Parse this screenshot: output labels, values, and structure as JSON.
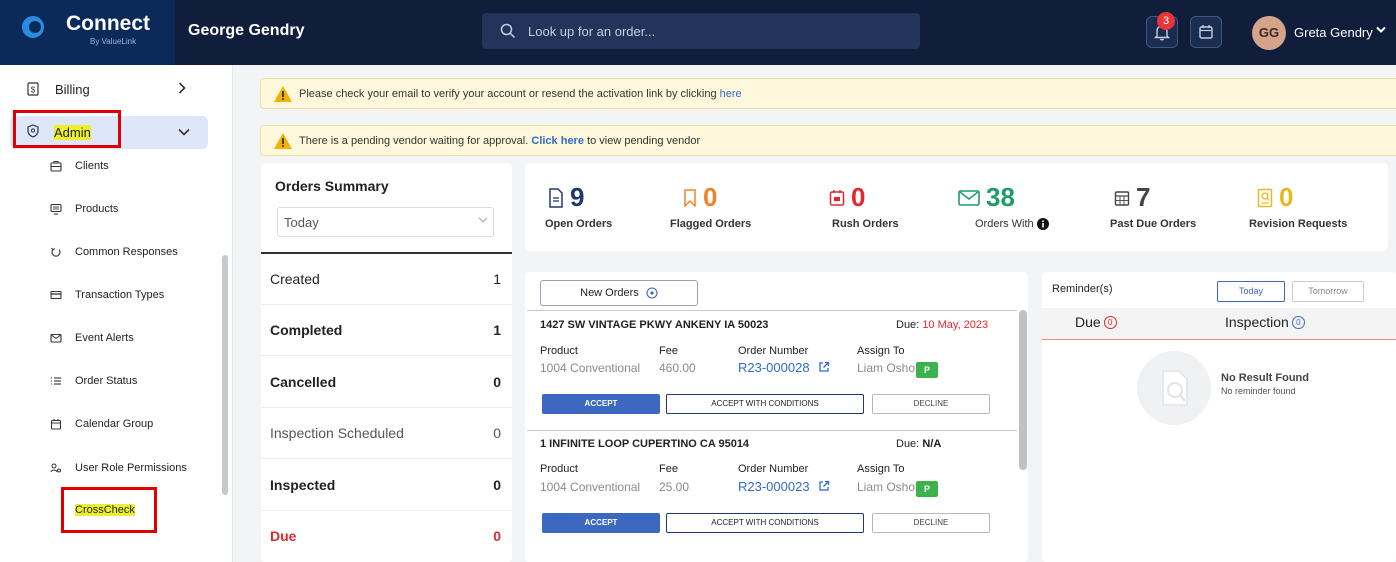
{
  "header": {
    "logo_text": "Connect",
    "logo_sub": "By ValueLink",
    "agent_name": "George Gendry",
    "search_placeholder": "Look up for an order...",
    "notification_count": "3",
    "avatar_initials": "GG",
    "user_name": "Greta Gendry"
  },
  "sidebar": {
    "billing_label": "Billing",
    "admin_label": "Admin",
    "items": [
      {
        "label": "Clients",
        "icon": "briefcase-icon"
      },
      {
        "label": "Products",
        "icon": "monitor-icon"
      },
      {
        "label": "Common Responses",
        "icon": "refresh-icon"
      },
      {
        "label": "Transaction Types",
        "icon": "credit-card-icon"
      },
      {
        "label": "Event Alerts",
        "icon": "mail-icon"
      },
      {
        "label": "Order Status",
        "icon": "list-icon"
      },
      {
        "label": "Calendar Group",
        "icon": "calendar-icon"
      },
      {
        "label": "User Role Permissions",
        "icon": "users-icon"
      },
      {
        "label": "CrossCheck",
        "icon": ""
      }
    ]
  },
  "banners": {
    "verify_text": "Please check your email to verify your account or resend the activation link by clicking",
    "verify_link": "here",
    "vendor_text_pre": "There is a pending vendor waiting for approval.",
    "vendor_link": "Click here",
    "vendor_text_post": "to view pending vendor"
  },
  "summary": {
    "title": "Orders Summary",
    "period": "Today",
    "rows": [
      {
        "label": "Created",
        "count": "1"
      },
      {
        "label": "Completed",
        "count": "1"
      },
      {
        "label": "Cancelled",
        "count": "0"
      },
      {
        "label": "Inspection Scheduled",
        "count": "0"
      },
      {
        "label": "Inspected",
        "count": "0"
      },
      {
        "label": "Due",
        "count": "0"
      }
    ]
  },
  "stats": [
    {
      "value": "9",
      "label": "Open Orders",
      "icon": "document-icon",
      "color": "#1f3a6a"
    },
    {
      "value": "0",
      "label": "Flagged Orders",
      "icon": "bookmark-icon",
      "color": "#f0842c"
    },
    {
      "value": "0",
      "label": "Rush Orders",
      "icon": "calendar-icon",
      "color": "#e0282e"
    },
    {
      "value": "38",
      "label": "Orders With",
      "icon": "mail-icon",
      "color": "#1f9c6a"
    },
    {
      "value": "7",
      "label": "Past Due Orders",
      "icon": "calendar-grid-icon",
      "color": "#444444"
    },
    {
      "value": "0",
      "label": "Revision Requests",
      "icon": "revision-icon",
      "color": "#e8b820"
    }
  ],
  "orders": {
    "new_orders_label": "New Orders",
    "col_product": "Product",
    "col_fee": "Fee",
    "col_number": "Order Number",
    "col_assign": "Assign To",
    "accept_label": "ACCEPT",
    "accept_cond_label": "ACCEPT WITH CONDITIONS",
    "decline_label": "DECLINE",
    "items": [
      {
        "address": "1427 SW VINTAGE PKWY ANKENY IA 50023",
        "due_label": "Due:",
        "due_date": "10 May, 2023",
        "product": "1004 Conventional",
        "fee": "460.00",
        "number": "R23-000028",
        "assignee": "Liam Osho",
        "badge": "P"
      },
      {
        "address": "1 INFINITE LOOP CUPERTINO CA 95014",
        "due_label": "Due:",
        "due_date": "N/A",
        "product": "1004 Conventional",
        "fee": "25.00",
        "number": "R23-000023",
        "assignee": "Liam Osho",
        "badge": "P"
      }
    ]
  },
  "reminders": {
    "title": "Reminder(s)",
    "today_label": "Today",
    "tomorrow_label": "Tomorrow",
    "tab_due": "Due",
    "tab_due_count": "0",
    "tab_inspection": "Inspection",
    "tab_inspection_count": "0",
    "empty_title": "No Result Found",
    "empty_sub": "No reminder found"
  }
}
